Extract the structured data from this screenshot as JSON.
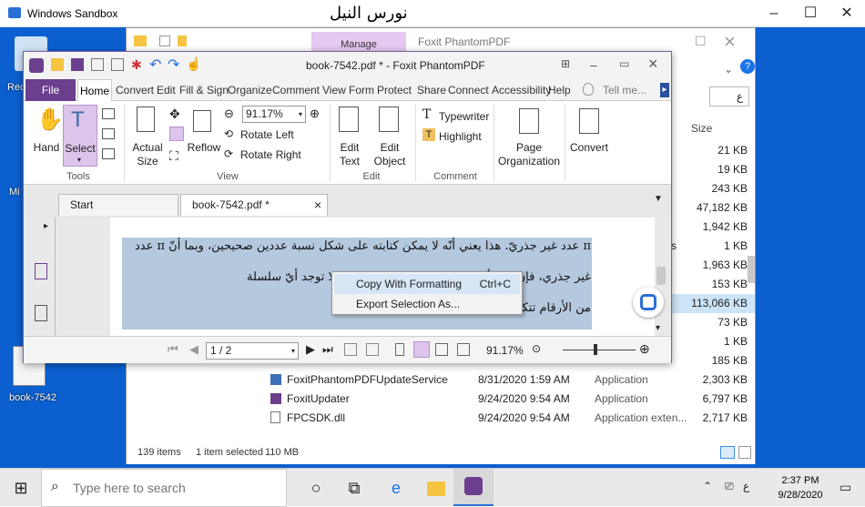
{
  "host": {
    "title": "Windows Sandbox",
    "caption": "نورس النيل",
    "controls": [
      "–",
      "☐",
      "✕"
    ]
  },
  "desktop": {
    "icons": [
      "Rec",
      "Mi",
      "book-7542"
    ]
  },
  "explorer": {
    "manage_tab": "Manage",
    "title": "Foxit PhantomPDF",
    "size_header": "Size",
    "search_placeholder": "ع",
    "rows": [
      {
        "name": "",
        "date": "",
        "type": "",
        "size": "21 KB"
      },
      {
        "name": "",
        "date": "",
        "type": "",
        "size": "19 KB"
      },
      {
        "name": "",
        "date": "",
        "type": "",
        "size": "243 KB"
      },
      {
        "name": "",
        "date": "",
        "type": "",
        "size": "47,182 KB"
      },
      {
        "name": "",
        "date": "",
        "type": "",
        "size": "1,942 KB"
      },
      {
        "name": "",
        "date": "",
        "type": "s",
        "size": "1 KB"
      },
      {
        "name": "",
        "date": "",
        "type": "",
        "size": "1,963 KB"
      },
      {
        "name": "",
        "date": "",
        "type": "",
        "size": "153 KB"
      },
      {
        "name": "",
        "date": "",
        "type": "",
        "size": "113,066 KB"
      },
      {
        "name": "",
        "date": "",
        "type": "",
        "size": "73 KB"
      },
      {
        "name": "",
        "date": "",
        "type": "",
        "size": "1 KB"
      },
      {
        "name": "",
        "date": "",
        "type": "",
        "size": "185 KB"
      },
      {
        "name": "FoxitPhantomPDFUpdateService",
        "date": "8/31/2020 1:59 AM",
        "type": "Application",
        "size": "2,303 KB"
      },
      {
        "name": "FoxitUpdater",
        "date": "9/24/2020 9:54 AM",
        "type": "Application",
        "size": "6,797 KB"
      },
      {
        "name": "FPCSDK.dll",
        "date": "9/24/2020 9:54 AM",
        "type": "Application exten...",
        "size": "2,717 KB"
      }
    ],
    "status": {
      "items": "139 items",
      "selected": "1 item selected",
      "size": "110 MB"
    }
  },
  "foxit": {
    "title": "book-7542.pdf * - Foxit PhantomPDF",
    "tabs": [
      "File",
      "Home",
      "Convert",
      "Edit",
      "Fill & Sign",
      "Organize",
      "Comment",
      "View",
      "Form",
      "Protect",
      "Share",
      "Connect",
      "Accessibility",
      "Help"
    ],
    "tell_me": "Tell me...",
    "tools": {
      "hand": "Hand",
      "select": "Select",
      "group": "Tools"
    },
    "view": {
      "actual_size": "Actual Size",
      "reflow": "Reflow",
      "zoom": "91.17%",
      "rotate_left": "Rotate Left",
      "rotate_right": "Rotate Right",
      "group": "View"
    },
    "edit": {
      "edit_text": "Edit Text",
      "edit_object": "Edit Object",
      "group": "Edit"
    },
    "comment": {
      "typewriter": "Typewriter",
      "highlight": "Highlight",
      "group": "Comment"
    },
    "page_org": "Page Organization",
    "convert": "Convert",
    "doc_tabs": [
      "Start",
      "book-7542.pdf *"
    ],
    "text_lines": [
      "π عدد غير جذريّ. هذا يعني أنّه لا يمكن كتابته على شكل نسبة عددين صحيحين، وبما أنّ π عدد",
      "غير جذري، فإنّ ... الأقل ... في تمثيله العشري، وإنّه لا توجد أيّ سلسلة",
      "من الأرقام تتكرّر ... أن π عدد غير جذريّ."
    ],
    "page_indicator": "1 / 2",
    "zoom_bottom": "91.17%"
  },
  "context_menu": {
    "copy": "Copy With Formatting",
    "copy_shortcut": "Ctrl+C",
    "export": "Export Selection As..."
  },
  "taskbar": {
    "search_placeholder": "Type here to search",
    "time": "2:37 PM",
    "date": "9/28/2020",
    "lang": "ع"
  }
}
